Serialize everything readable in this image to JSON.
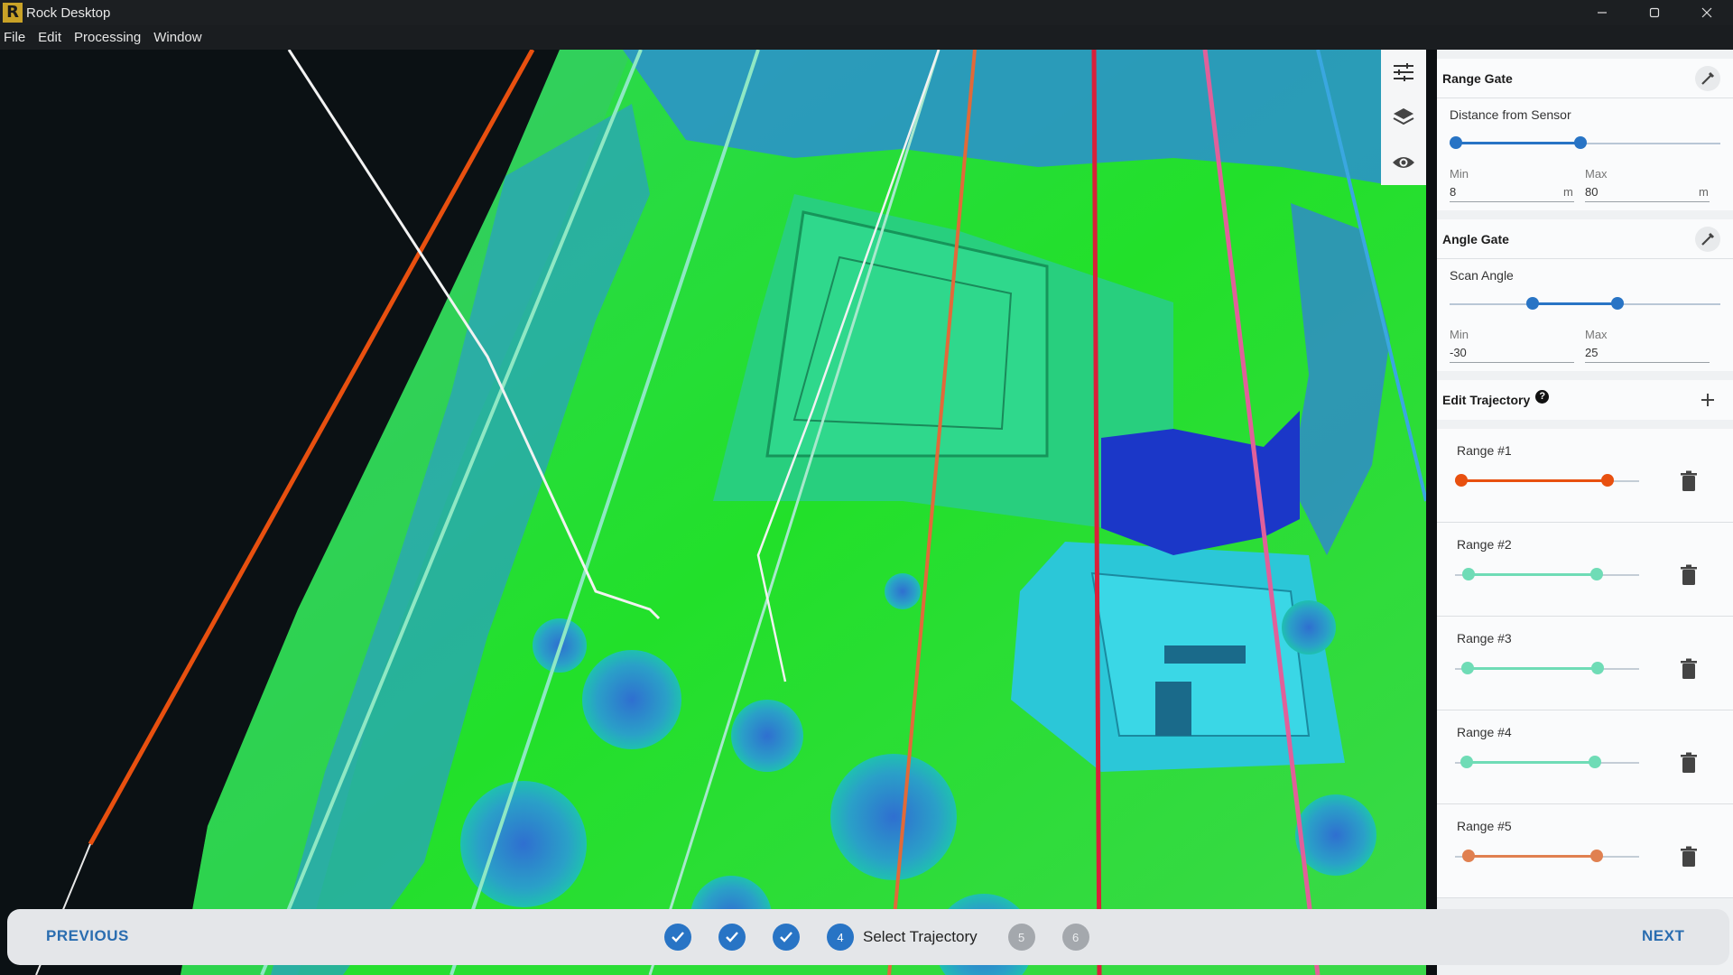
{
  "app": {
    "title": "Rock Desktop",
    "logo_letter": "R"
  },
  "menu": [
    "File",
    "Edit",
    "Processing",
    "Window"
  ],
  "panel": {
    "range_gate": {
      "title": "Range Gate",
      "slider_label": "Distance from Sensor",
      "min_label": "Min",
      "max_label": "Max",
      "min_value": "8",
      "max_value": "80",
      "unit": "m"
    },
    "angle_gate": {
      "title": "Angle Gate",
      "slider_label": "Scan Angle",
      "min_label": "Min",
      "max_label": "Max",
      "min_value": "-30",
      "max_value": "25"
    },
    "edit_trajectory": {
      "title": "Edit Trajectory",
      "help": "?",
      "ranges": [
        {
          "label": "Range #1",
          "color": "#e8500f"
        },
        {
          "label": "Range #2",
          "color": "#6fdcb6"
        },
        {
          "label": "Range #3",
          "color": "#6fdcb6"
        },
        {
          "label": "Range #4",
          "color": "#6fdcb6"
        },
        {
          "label": "Range #5",
          "color": "#e08050"
        }
      ]
    }
  },
  "wizard": {
    "previous_label": "PREVIOUS",
    "next_label": "NEXT",
    "current_step_number": "4",
    "current_step_label": "Select Trajectory",
    "pending_steps": [
      "5",
      "6"
    ]
  },
  "colors": {
    "accent": "#2874c5",
    "trajectory_orange": "#e8500f",
    "trajectory_red": "#d9203a",
    "trajectory_pink": "#e0609a"
  }
}
